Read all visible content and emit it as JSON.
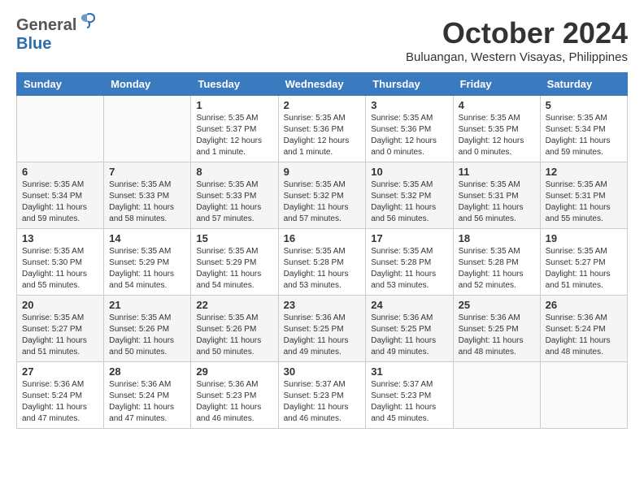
{
  "header": {
    "logo_general": "General",
    "logo_blue": "Blue",
    "month": "October 2024",
    "location": "Buluangan, Western Visayas, Philippines"
  },
  "days_of_week": [
    "Sunday",
    "Monday",
    "Tuesday",
    "Wednesday",
    "Thursday",
    "Friday",
    "Saturday"
  ],
  "weeks": [
    [
      {
        "day": "",
        "info": ""
      },
      {
        "day": "",
        "info": ""
      },
      {
        "day": "1",
        "info": "Sunrise: 5:35 AM\nSunset: 5:37 PM\nDaylight: 12 hours\nand 1 minute."
      },
      {
        "day": "2",
        "info": "Sunrise: 5:35 AM\nSunset: 5:36 PM\nDaylight: 12 hours\nand 1 minute."
      },
      {
        "day": "3",
        "info": "Sunrise: 5:35 AM\nSunset: 5:36 PM\nDaylight: 12 hours\nand 0 minutes."
      },
      {
        "day": "4",
        "info": "Sunrise: 5:35 AM\nSunset: 5:35 PM\nDaylight: 12 hours\nand 0 minutes."
      },
      {
        "day": "5",
        "info": "Sunrise: 5:35 AM\nSunset: 5:34 PM\nDaylight: 11 hours\nand 59 minutes."
      }
    ],
    [
      {
        "day": "6",
        "info": "Sunrise: 5:35 AM\nSunset: 5:34 PM\nDaylight: 11 hours\nand 59 minutes."
      },
      {
        "day": "7",
        "info": "Sunrise: 5:35 AM\nSunset: 5:33 PM\nDaylight: 11 hours\nand 58 minutes."
      },
      {
        "day": "8",
        "info": "Sunrise: 5:35 AM\nSunset: 5:33 PM\nDaylight: 11 hours\nand 57 minutes."
      },
      {
        "day": "9",
        "info": "Sunrise: 5:35 AM\nSunset: 5:32 PM\nDaylight: 11 hours\nand 57 minutes."
      },
      {
        "day": "10",
        "info": "Sunrise: 5:35 AM\nSunset: 5:32 PM\nDaylight: 11 hours\nand 56 minutes."
      },
      {
        "day": "11",
        "info": "Sunrise: 5:35 AM\nSunset: 5:31 PM\nDaylight: 11 hours\nand 56 minutes."
      },
      {
        "day": "12",
        "info": "Sunrise: 5:35 AM\nSunset: 5:31 PM\nDaylight: 11 hours\nand 55 minutes."
      }
    ],
    [
      {
        "day": "13",
        "info": "Sunrise: 5:35 AM\nSunset: 5:30 PM\nDaylight: 11 hours\nand 55 minutes."
      },
      {
        "day": "14",
        "info": "Sunrise: 5:35 AM\nSunset: 5:29 PM\nDaylight: 11 hours\nand 54 minutes."
      },
      {
        "day": "15",
        "info": "Sunrise: 5:35 AM\nSunset: 5:29 PM\nDaylight: 11 hours\nand 54 minutes."
      },
      {
        "day": "16",
        "info": "Sunrise: 5:35 AM\nSunset: 5:28 PM\nDaylight: 11 hours\nand 53 minutes."
      },
      {
        "day": "17",
        "info": "Sunrise: 5:35 AM\nSunset: 5:28 PM\nDaylight: 11 hours\nand 53 minutes."
      },
      {
        "day": "18",
        "info": "Sunrise: 5:35 AM\nSunset: 5:28 PM\nDaylight: 11 hours\nand 52 minutes."
      },
      {
        "day": "19",
        "info": "Sunrise: 5:35 AM\nSunset: 5:27 PM\nDaylight: 11 hours\nand 51 minutes."
      }
    ],
    [
      {
        "day": "20",
        "info": "Sunrise: 5:35 AM\nSunset: 5:27 PM\nDaylight: 11 hours\nand 51 minutes."
      },
      {
        "day": "21",
        "info": "Sunrise: 5:35 AM\nSunset: 5:26 PM\nDaylight: 11 hours\nand 50 minutes."
      },
      {
        "day": "22",
        "info": "Sunrise: 5:35 AM\nSunset: 5:26 PM\nDaylight: 11 hours\nand 50 minutes."
      },
      {
        "day": "23",
        "info": "Sunrise: 5:36 AM\nSunset: 5:25 PM\nDaylight: 11 hours\nand 49 minutes."
      },
      {
        "day": "24",
        "info": "Sunrise: 5:36 AM\nSunset: 5:25 PM\nDaylight: 11 hours\nand 49 minutes."
      },
      {
        "day": "25",
        "info": "Sunrise: 5:36 AM\nSunset: 5:25 PM\nDaylight: 11 hours\nand 48 minutes."
      },
      {
        "day": "26",
        "info": "Sunrise: 5:36 AM\nSunset: 5:24 PM\nDaylight: 11 hours\nand 48 minutes."
      }
    ],
    [
      {
        "day": "27",
        "info": "Sunrise: 5:36 AM\nSunset: 5:24 PM\nDaylight: 11 hours\nand 47 minutes."
      },
      {
        "day": "28",
        "info": "Sunrise: 5:36 AM\nSunset: 5:24 PM\nDaylight: 11 hours\nand 47 minutes."
      },
      {
        "day": "29",
        "info": "Sunrise: 5:36 AM\nSunset: 5:23 PM\nDaylight: 11 hours\nand 46 minutes."
      },
      {
        "day": "30",
        "info": "Sunrise: 5:37 AM\nSunset: 5:23 PM\nDaylight: 11 hours\nand 46 minutes."
      },
      {
        "day": "31",
        "info": "Sunrise: 5:37 AM\nSunset: 5:23 PM\nDaylight: 11 hours\nand 45 minutes."
      },
      {
        "day": "",
        "info": ""
      },
      {
        "day": "",
        "info": ""
      }
    ]
  ]
}
